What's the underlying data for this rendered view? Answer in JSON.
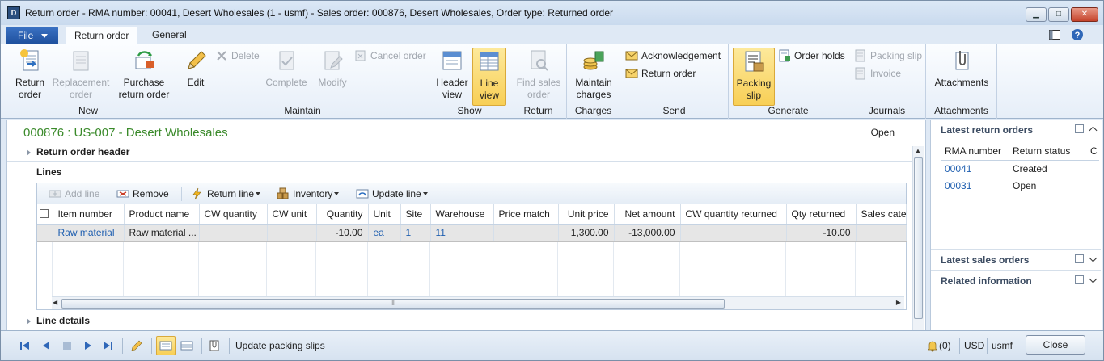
{
  "window": {
    "title": "Return order  -  RMA number: 00041,  Desert Wholesales (1 - usmf) - Sales order: 000876, Desert Wholesales, Order type: Returned order",
    "min_glyph": "▁",
    "max_glyph": "□",
    "close_glyph": "✕"
  },
  "tabs": {
    "file": "File",
    "return_order": "Return order",
    "general": "General"
  },
  "ribbon": {
    "new": {
      "label": "New",
      "return_order": "Return order",
      "replacement_order": "Replacement order",
      "purchase_return_order": "Purchase return order"
    },
    "maintain": {
      "label": "Maintain",
      "edit": "Edit",
      "delete": "Delete",
      "complete": "Complete",
      "modify": "Modify",
      "cancel_order": "Cancel order"
    },
    "show": {
      "label": "Show",
      "header_view": "Header view",
      "line_view": "Line view"
    },
    "return": {
      "label": "Return",
      "find_sales_order": "Find sales order"
    },
    "charges": {
      "label": "Charges",
      "maintain_charges": "Maintain charges"
    },
    "send": {
      "label": "Send",
      "acknowledgement": "Acknowledgement",
      "return_order": "Return order"
    },
    "generate": {
      "label": "Generate",
      "packing_slip": "Packing slip",
      "order_holds": "Order holds"
    },
    "journals": {
      "label": "Journals",
      "packing_slip": "Packing slip",
      "invoice": "Invoice"
    },
    "attachments": {
      "label": "Attachments",
      "attachments": "Attachments"
    }
  },
  "record": {
    "title": "000876 : US-007 - Desert Wholesales",
    "status": "Open"
  },
  "fasttabs": {
    "header": "Return order header",
    "lines": "Lines",
    "details": "Line details"
  },
  "lines_toolbar": {
    "add_line": "Add line",
    "remove": "Remove",
    "return_line": "Return line",
    "inventory": "Inventory",
    "update_line": "Update line"
  },
  "grid": {
    "columns": [
      "Item number",
      "Product name",
      "CW quantity",
      "CW unit",
      "Quantity",
      "Unit",
      "Site",
      "Warehouse",
      "Price match",
      "Unit price",
      "Net amount",
      "CW quantity returned",
      "Qty returned",
      "Sales categ"
    ],
    "rows": [
      {
        "item_number": "Raw material",
        "product_name": "Raw material ...",
        "cw_quantity": "",
        "cw_unit": "",
        "quantity": "-10.00",
        "unit": "ea",
        "site": "1",
        "warehouse": "11",
        "price_match": "",
        "unit_price": "1,300.00",
        "net_amount": "-13,000.00",
        "cw_quantity_returned": "",
        "qty_returned": "-10.00",
        "sales_category": ""
      }
    ],
    "scroll_grip": "III"
  },
  "factbox": {
    "latest_return_orders": {
      "title": "Latest return orders",
      "columns": [
        "RMA number",
        "Return status",
        "C"
      ],
      "rows": [
        {
          "rma": "00041",
          "status": "Created"
        },
        {
          "rma": "00031",
          "status": "Open"
        }
      ]
    },
    "latest_sales_orders": "Latest sales orders",
    "related_information": "Related information"
  },
  "statusbar": {
    "message": "Update packing slips",
    "alerts": "(0)",
    "currency": "USD",
    "company": "usmf",
    "close": "Close"
  },
  "colors": {
    "accent": "#1e4f9c",
    "record_title": "#3a8a2a",
    "link": "#1f5fb0",
    "selected_button": "#f8cf56"
  }
}
